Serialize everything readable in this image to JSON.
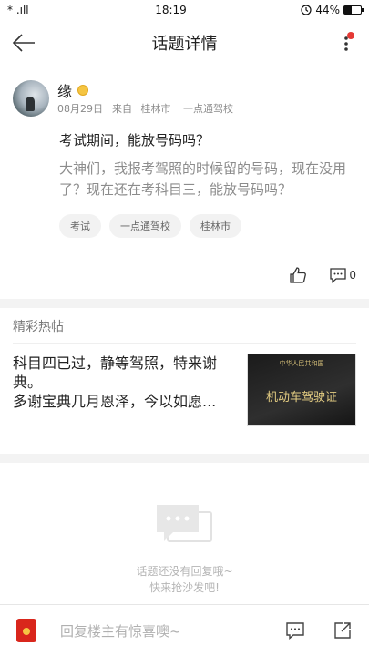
{
  "status_bar": {
    "left_text": "* .ıll",
    "time": "18:19",
    "battery_text": "44%",
    "battery_level_percent": 44,
    "icons": [
      "signal-icon",
      "alarm-icon",
      "battery-icon"
    ]
  },
  "nav": {
    "title": "话题详情",
    "back_icon": "arrow-left-icon",
    "more_icon": "more-vertical-icon",
    "badge_color": "#e53935"
  },
  "post": {
    "author": "缘",
    "level_icon": "level-badge-icon",
    "date": "08月29日",
    "from_label": "来自",
    "city": "桂林市",
    "school": "一点通驾校",
    "title": "考试期间，能放号码吗？",
    "body": "大神们，我报考驾照的时候留的号码，现在没用了？现在还在考科目三，能放号码吗？",
    "tags": [
      "考试",
      "一点通驾校",
      "桂林市"
    ],
    "comment_count": "0"
  },
  "hot": {
    "header": "精彩热帖",
    "item_text_line1": "科目四已过，静等驾照，特来谢典。",
    "item_text_line2": "多谢宝典几月恩泽，今以如愿...",
    "thumb_small_text": "中华人民共和国",
    "thumb_big_text": "机动车驾驶证"
  },
  "empty": {
    "line1": "话题还没有回复哦~",
    "line2": "快来抢沙发吧!"
  },
  "reply_bar": {
    "placeholder": "回复楼主有惊喜噢~"
  },
  "colors": {
    "accent_red": "#d9261c",
    "divider": "#f3f3f3"
  }
}
